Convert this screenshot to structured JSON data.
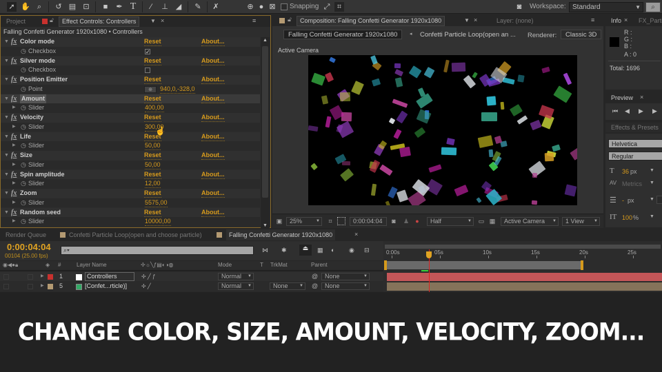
{
  "toolbar": {
    "snapping_label": "Snapping",
    "workspace_label": "Workspace:",
    "workspace_value": "Standard",
    "icons": [
      "selection-tool-icon",
      "hand-tool-icon",
      "zoom-tool-icon",
      "rotate-tool-icon",
      "camera-tool-icon",
      "pan-behind-tool-icon",
      "rectangle-tool-icon",
      "pen-tool-icon",
      "type-tool-icon",
      "brush-tool-icon",
      "clone-stamp-tool-icon",
      "eraser-tool-icon",
      "roto-brush-tool-icon",
      "puppet-pin-tool-icon"
    ]
  },
  "effect_controls": {
    "tab_project": "Project",
    "tab_label": "Effect Controls: Controllers",
    "subtitle": "Falling Confetti Generator 1920x1080 • Controllers",
    "reset_label": "Reset",
    "about_label": "About...",
    "effects": [
      {
        "name": "Color mode",
        "param": "Checkbox",
        "type": "checkbox",
        "checked": true
      },
      {
        "name": "Silver mode",
        "param": "Checkbox",
        "type": "checkbox",
        "checked": false
      },
      {
        "name": "Position Emitter",
        "param": "Point",
        "type": "point",
        "value": "940,0,-328,0"
      },
      {
        "name": "Amount",
        "param": "Slider",
        "type": "slider",
        "value": "400,00"
      },
      {
        "name": "Velocity",
        "param": "Slider",
        "type": "slider",
        "value": "300,00"
      },
      {
        "name": "Life",
        "param": "Slider",
        "type": "slider",
        "value": "50,00"
      },
      {
        "name": "Size",
        "param": "Slider",
        "type": "slider",
        "value": "50,00"
      },
      {
        "name": "Spin amplitude",
        "param": "Slider",
        "type": "slider",
        "value": "12,00"
      },
      {
        "name": "Zoom",
        "param": "Slider",
        "type": "slider",
        "value": "5575,00"
      },
      {
        "name": "Random seed",
        "param": "Slider",
        "type": "slider",
        "value": "10000,00"
      }
    ]
  },
  "composition": {
    "tab_label": "Composition: Falling Confetti Generator 1920x1080",
    "layer_tab": "Layer: (none)",
    "crumb_active": "Falling Confetti Generator 1920x1080",
    "crumb_other": "Confetti Particle Loop(open an ...",
    "renderer_label": "Renderer:",
    "renderer_value": "Classic 3D",
    "view_label": "Active Camera",
    "footer": {
      "zoom": "25%",
      "timecode": "0:00:04:04",
      "resolution": "Half",
      "camera": "Active Camera",
      "views": "1 View"
    }
  },
  "info": {
    "tab": "Info",
    "tab2": "FX_Parti",
    "r_label": "R :",
    "g_label": "G :",
    "b_label": "B :",
    "a_label": "A : 0",
    "total": "Total: 1696"
  },
  "preview": {
    "tab": "Preview"
  },
  "effects_presets": {
    "tab": "Effects & Presets"
  },
  "character": {
    "font": "Helvetica",
    "style": "Regular",
    "size": "36",
    "size_unit": "px",
    "kerning": "Metrics",
    "leading": "-",
    "leading_unit": "px",
    "scale": "100",
    "scale_unit": "%"
  },
  "timeline": {
    "tabs": [
      "Render Queue",
      "Confetti Particle Loop(open and choose particle)",
      "Falling Confetti Generator 1920x1080"
    ],
    "timecode": "0:00:04:04",
    "frame_info": "00104 (25.00 fps)",
    "search_placeholder": "",
    "columns": {
      "number": "#",
      "layer_name": "Layer Name",
      "mode": "Mode",
      "t": "T",
      "trkmat": "TrkMat",
      "parent": "Parent"
    },
    "ruler_ticks": [
      "0:00s",
      "05s",
      "10s",
      "15s",
      "20s",
      "25s"
    ],
    "current_time_fraction": 0.165,
    "layers": [
      {
        "num": "1",
        "name": "Controllers",
        "color": "#c8312e",
        "mode": "Normal",
        "trkmat": "",
        "parent": "None"
      },
      {
        "num": "5",
        "name": "[Confet...rticle)]",
        "color": "#b49a72",
        "mode": "Normal",
        "trkmat": "None",
        "parent": "None"
      }
    ]
  },
  "caption": "CHANGE COLOR, SIZE, AMOUNT, VELOCITY, ZOOM..."
}
